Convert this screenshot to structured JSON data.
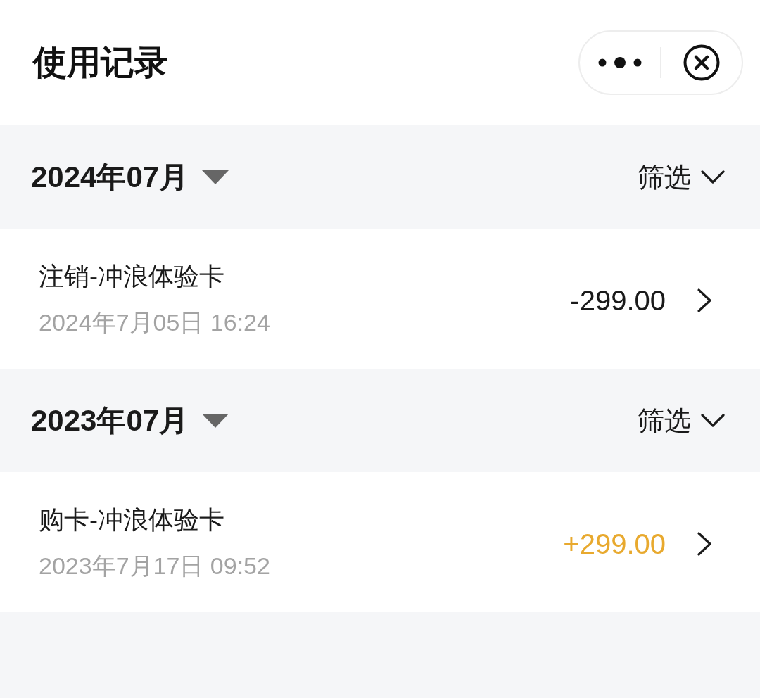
{
  "title": "使用记录",
  "sections": [
    {
      "month": "2024年07月",
      "filter": "筛选",
      "records": [
        {
          "title": "注销-冲浪体验卡",
          "time": "2024年7月05日 16:24",
          "amount": "-299.00",
          "color": "#1a1a1a"
        }
      ]
    },
    {
      "month": "2023年07月",
      "filter": "筛选",
      "records": [
        {
          "title": "购卡-冲浪体验卡",
          "time": "2023年7月17日 09:52",
          "amount": "+299.00",
          "color": "#e8a92e"
        }
      ]
    }
  ]
}
